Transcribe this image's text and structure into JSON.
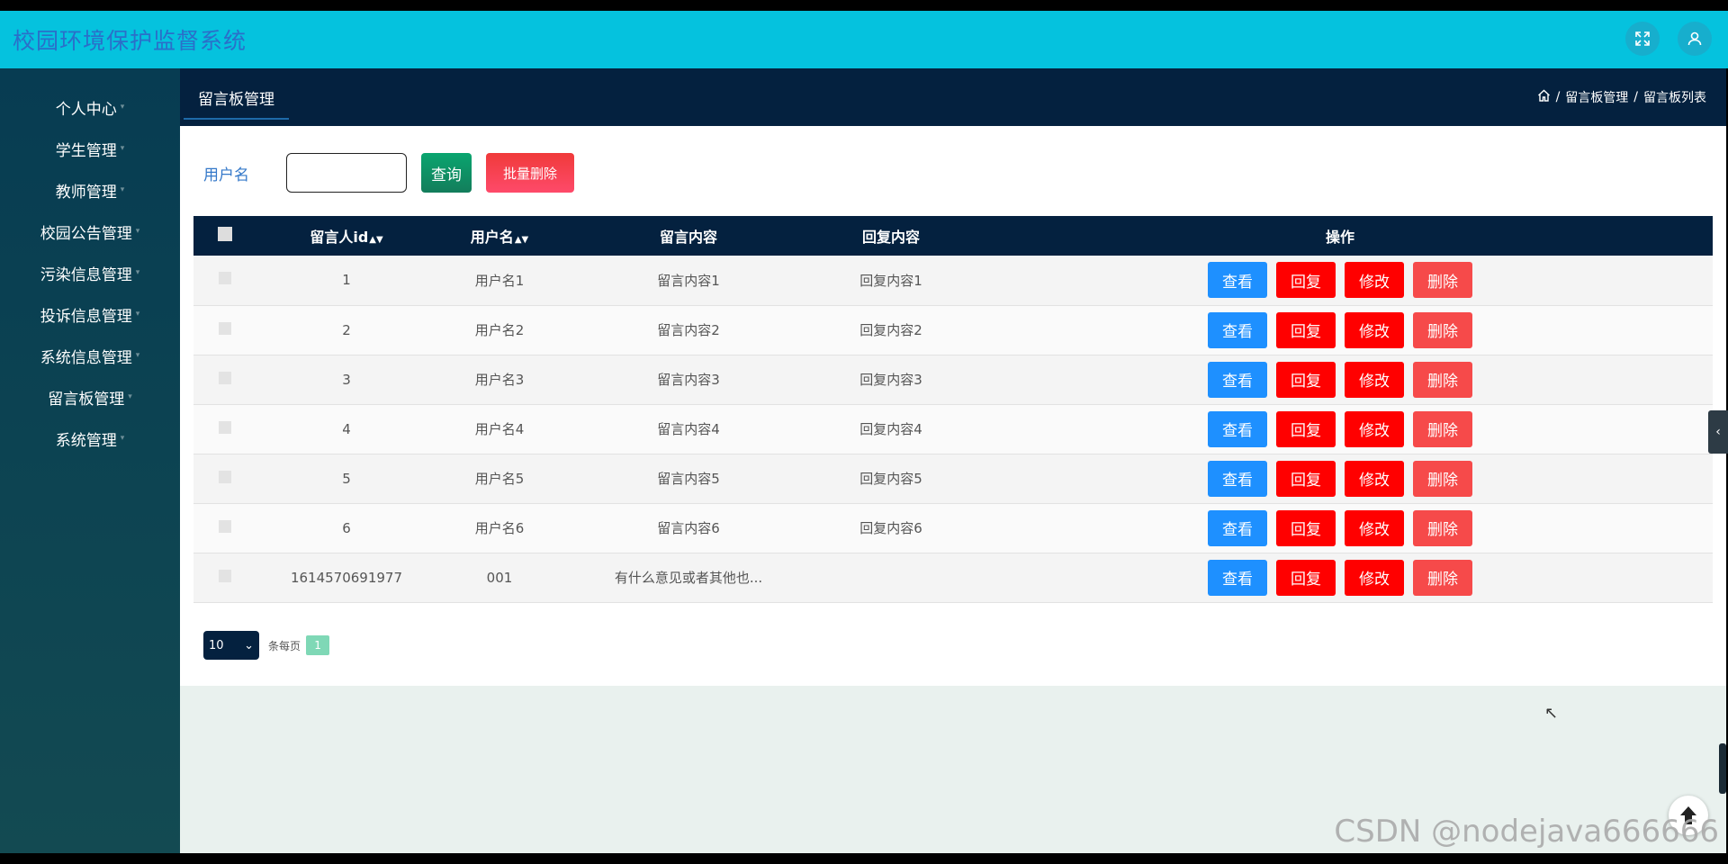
{
  "app": {
    "title": "校园环境保护监督系统"
  },
  "header": {
    "icons": [
      "fullscreen-icon",
      "user-icon"
    ]
  },
  "sidebar": {
    "items": [
      {
        "label": "个人中心"
      },
      {
        "label": "学生管理"
      },
      {
        "label": "教师管理"
      },
      {
        "label": "校园公告管理"
      },
      {
        "label": "污染信息管理"
      },
      {
        "label": "投诉信息管理"
      },
      {
        "label": "系统信息管理"
      },
      {
        "label": "留言板管理"
      },
      {
        "label": "系统管理"
      }
    ]
  },
  "subbar": {
    "tab": "留言板管理",
    "breadcrumb": {
      "item1": "留言板管理",
      "item2": "留言板列表",
      "separator": "/"
    }
  },
  "search": {
    "label": "用户名",
    "value": "",
    "query_button": "查询",
    "batch_delete_button": "批量删除"
  },
  "table": {
    "headers": {
      "id": "留言人id",
      "username": "用户名",
      "content": "留言内容",
      "reply": "回复内容",
      "actions": "操作"
    },
    "rows": [
      {
        "id": "1",
        "username": "用户名1",
        "content": "留言内容1",
        "reply": "回复内容1"
      },
      {
        "id": "2",
        "username": "用户名2",
        "content": "留言内容2",
        "reply": "回复内容2"
      },
      {
        "id": "3",
        "username": "用户名3",
        "content": "留言内容3",
        "reply": "回复内容3"
      },
      {
        "id": "4",
        "username": "用户名4",
        "content": "留言内容4",
        "reply": "回复内容4"
      },
      {
        "id": "5",
        "username": "用户名5",
        "content": "留言内容5",
        "reply": "回复内容5"
      },
      {
        "id": "6",
        "username": "用户名6",
        "content": "留言内容6",
        "reply": "回复内容6"
      },
      {
        "id": "1614570691977",
        "username": "001",
        "content": "有什么意见或者其他也...",
        "reply": ""
      }
    ],
    "actions": {
      "view": "查看",
      "reply": "回复",
      "edit": "修改",
      "delete": "删除"
    }
  },
  "pager": {
    "page_size": "10",
    "per_page_label": "条每页",
    "current_page": "1"
  },
  "watermark": "CSDN @nodejava666666",
  "colors": {
    "header_bg": "#05c2de",
    "title_color": "#2a6fc9",
    "navy": "#04213f",
    "query_green": "#0aa56f",
    "danger_red": "#ff0000",
    "view_blue": "#1e90ff"
  }
}
